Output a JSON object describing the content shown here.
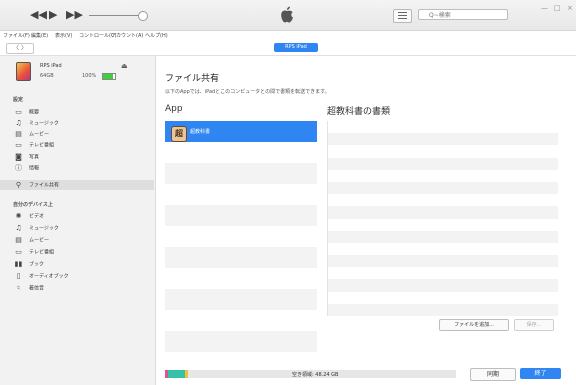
{
  "window": {
    "controls": {
      "minimize": "—",
      "maximize": "□",
      "close": "×"
    }
  },
  "player": {
    "prev_icon": "rewind-icon",
    "play_icon": "play-icon",
    "next_icon": "fast-forward-icon"
  },
  "search": {
    "placeholder": "Q~検索"
  },
  "menubar": [
    "ファイル(F)",
    "編集(E)",
    "表示(V)",
    "コントロール(C)",
    "アカウント(A)",
    "ヘルプ(H)"
  ],
  "nav": {
    "arrows": "〈 〉",
    "device_pill": "RPS iPad"
  },
  "device": {
    "name": "RPS iPad",
    "capacity": "64GB",
    "battery": "100%",
    "eject": "⏏"
  },
  "sidebar": {
    "settings_header": "設定",
    "settings_items": [
      {
        "label": "概要",
        "icon": "▭"
      },
      {
        "label": "ミュージック",
        "icon": "♫"
      },
      {
        "label": "ムービー",
        "icon": "▤"
      },
      {
        "label": "テレビ番組",
        "icon": "▭"
      },
      {
        "label": "写真",
        "icon": "◙"
      },
      {
        "label": "情報",
        "icon": "ⓘ"
      },
      {
        "label": "ファイル共有",
        "icon": "⚲"
      }
    ],
    "device_header": "自分のデバイス上",
    "device_items": [
      {
        "label": "ビデオ",
        "icon": "✺"
      },
      {
        "label": "ミュージック",
        "icon": "♫"
      },
      {
        "label": "ムービー",
        "icon": "▤"
      },
      {
        "label": "テレビ番組",
        "icon": "▭"
      },
      {
        "label": "ブック",
        "icon": "▮▮"
      },
      {
        "label": "オーディオブック",
        "icon": "▯"
      },
      {
        "label": "着信音",
        "icon": "♮"
      }
    ]
  },
  "main": {
    "title": "ファイル共有",
    "description": "以下のAppでは、iPadとこのコンピュータとの間で書類を転送できます。",
    "app_column_header": "App",
    "docs_column_header": "超教科書の書類",
    "apps": [
      {
        "label": "超教科書",
        "icon_glyph": "超"
      }
    ],
    "add_file_button": "ファイルを追加...",
    "save_button": "保存...",
    "storage_label": "空き領域: 48.24 GB",
    "sync_button": "同期",
    "done_button": "終了",
    "storage_segments": [
      {
        "color": "#e4508f",
        "fraction": 0.01
      },
      {
        "color": "#35c2a9",
        "fraction": 0.06
      },
      {
        "color": "#f1c232",
        "fraction": 0.01
      }
    ]
  },
  "colors": {
    "accent": "#2f86f2"
  }
}
